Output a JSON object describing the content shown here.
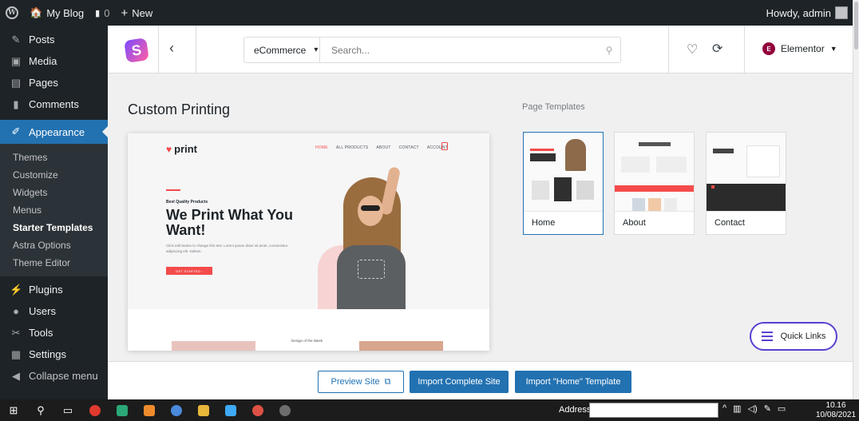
{
  "adminbar": {
    "site_name": "My Blog",
    "comments_count": "0",
    "new_label": "New",
    "howdy": "Howdy, admin"
  },
  "sidebar": {
    "top_items": [
      {
        "label": "Posts",
        "icon": "pin-icon"
      },
      {
        "label": "Media",
        "icon": "media-icon"
      },
      {
        "label": "Pages",
        "icon": "pages-icon"
      },
      {
        "label": "Comments",
        "icon": "comment-icon"
      }
    ],
    "active_item": {
      "label": "Appearance",
      "icon": "brush-icon"
    },
    "submenu": [
      "Themes",
      "Customize",
      "Widgets",
      "Menus",
      "Starter Templates",
      "Astra Options",
      "Theme Editor"
    ],
    "current_submenu": "Starter Templates",
    "bottom_items": [
      {
        "label": "Plugins",
        "icon": "plug-icon"
      },
      {
        "label": "Users",
        "icon": "user-icon"
      },
      {
        "label": "Tools",
        "icon": "wrench-icon"
      },
      {
        "label": "Settings",
        "icon": "settings-icon"
      },
      {
        "label": "Collapse menu",
        "icon": "collapse-icon"
      }
    ]
  },
  "topbar": {
    "category": "eCommerce",
    "search_placeholder": "Search...",
    "builder": "Elementor"
  },
  "page": {
    "title": "Custom Printing",
    "templates_heading": "Page Templates"
  },
  "preview": {
    "logo": "print",
    "nav": [
      "HOME",
      "ALL PRODUCTS",
      "ABOUT",
      "CONTACT",
      "ACCOUNT"
    ],
    "kicker": "Best Quality Products",
    "headline": "We Print What You Want!",
    "body": "Click edit button to change this text. Lorem ipsum dolor sit amet, consectetur adipiscing elit. Nullam.",
    "cta": "GET STARTED",
    "week": "Design of the Week"
  },
  "templates": [
    {
      "label": "Home",
      "selected": true
    },
    {
      "label": "About",
      "selected": false
    },
    {
      "label": "Contact",
      "selected": false
    }
  ],
  "quick_links": "Quick Links",
  "footer": {
    "preview_site": "Preview Site",
    "import_site": "Import Complete Site",
    "import_template": "Import \"Home\" Template"
  },
  "taskbar": {
    "address_label": "Address",
    "time": "10.16",
    "date": "10/08/2021"
  },
  "colors": {
    "accent": "#2271b1",
    "admin_dark": "#1d2327",
    "brand_red": "#f44b4b",
    "quick_links_border": "#5b3fd1"
  }
}
